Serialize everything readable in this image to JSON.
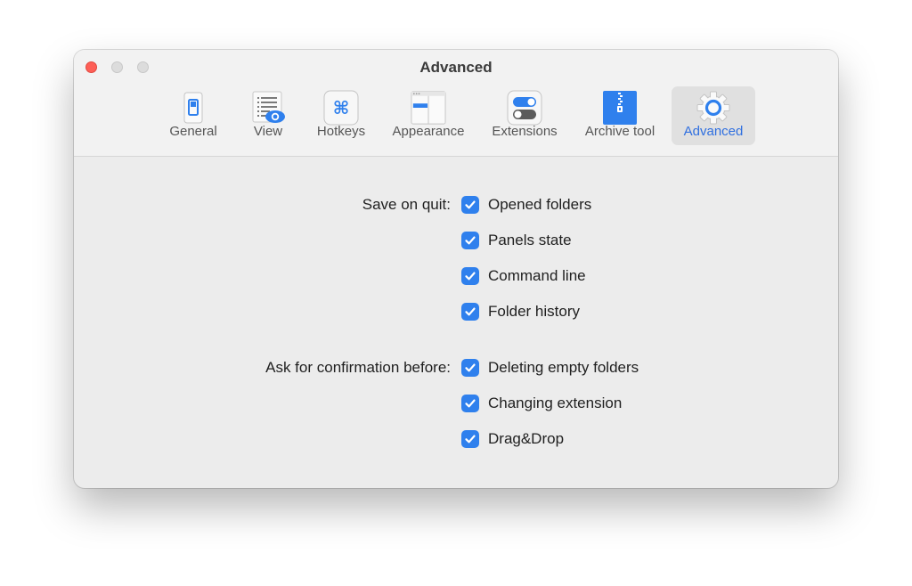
{
  "window": {
    "title": "Advanced"
  },
  "tabs": [
    {
      "label": "General",
      "icon": "general-switch-icon",
      "active": false
    },
    {
      "label": "View",
      "icon": "view-list-eye-icon",
      "active": false
    },
    {
      "label": "Hotkeys",
      "icon": "command-key-icon",
      "active": false
    },
    {
      "label": "Appearance",
      "icon": "appearance-layout-icon",
      "active": false
    },
    {
      "label": "Extensions",
      "icon": "toggle-switches-icon",
      "active": false
    },
    {
      "label": "Archive tool",
      "icon": "zip-archive-icon",
      "active": false
    },
    {
      "label": "Advanced",
      "icon": "gear-icon",
      "active": true
    }
  ],
  "save_on_quit": {
    "label": "Save on quit:",
    "options": [
      {
        "label": "Opened folders",
        "checked": true
      },
      {
        "label": "Panels state",
        "checked": true
      },
      {
        "label": "Command line",
        "checked": true
      },
      {
        "label": "Folder history",
        "checked": true
      }
    ]
  },
  "confirmation": {
    "label": "Ask for confirmation before:",
    "options": [
      {
        "label": "Deleting empty folders",
        "checked": true
      },
      {
        "label": "Changing extension",
        "checked": true
      },
      {
        "label": "Drag&Drop",
        "checked": true
      }
    ]
  },
  "colors": {
    "accent": "#2f80ed",
    "close": "#fe5f57"
  }
}
